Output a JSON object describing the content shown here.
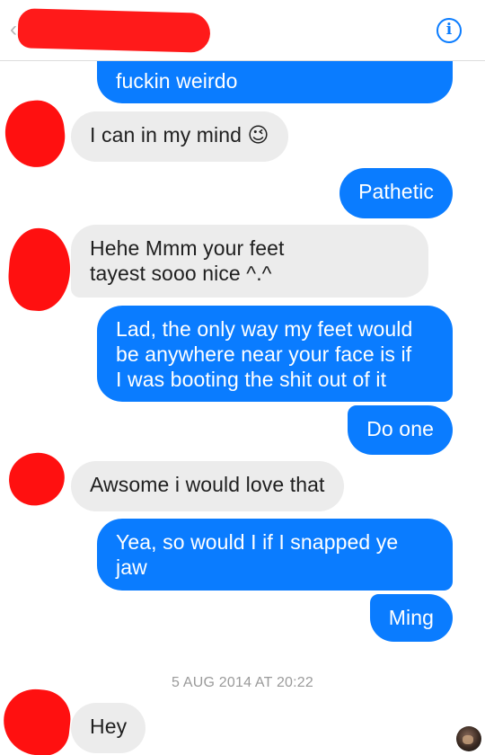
{
  "header": {
    "back_glyph": "‹",
    "back_icon": "chevron-left-icon",
    "info_glyph": "i",
    "info_icon": "info-icon",
    "accent_color": "#0a7cff"
  },
  "messages": [
    {
      "id": "m1",
      "direction": "outgoing",
      "text": "fuckin weirdo"
    },
    {
      "id": "m2",
      "direction": "incoming",
      "text": "I can in my mind 😉"
    },
    {
      "id": "m3",
      "direction": "outgoing",
      "text": "Pathetic"
    },
    {
      "id": "m4",
      "direction": "incoming",
      "text": "Hehe Mmm your feet\ntayest sooo nice ^.^"
    },
    {
      "id": "m5",
      "direction": "outgoing",
      "text": "Lad, the only way my feet would\nbe anywhere near your face is if\nI was booting the shit out of it"
    },
    {
      "id": "m6",
      "direction": "outgoing",
      "text": "Do one"
    },
    {
      "id": "m7",
      "direction": "incoming",
      "text": "Awsome i would love that"
    },
    {
      "id": "m8",
      "direction": "outgoing",
      "text": "Yea, so would I if I snapped ye\njaw"
    },
    {
      "id": "m9",
      "direction": "outgoing",
      "text": "Ming"
    },
    {
      "id": "m10",
      "direction": "incoming",
      "text": "Hey"
    }
  ],
  "timestamp": "5 AUG 2014 AT 20:22",
  "colors": {
    "outgoing_bubble": "#0a7cff",
    "incoming_bubble": "#ececec",
    "redaction": "#ff1a1a"
  }
}
